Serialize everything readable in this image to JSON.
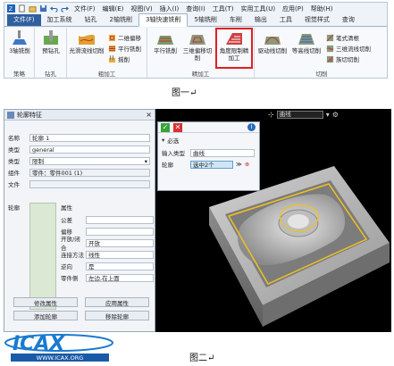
{
  "ribbon": {
    "quick_access_icons": [
      "zw-logo-icon",
      "new-icon",
      "open-icon",
      "save-icon",
      "undo-icon",
      "redo-icon"
    ],
    "menu": [
      "文件(F)",
      "编辑(E)",
      "视图(V)",
      "插入(I)",
      "查询(I)",
      "工具(T)",
      "实用工具(U)",
      "应用(P)",
      "帮助(H)"
    ],
    "tabs": [
      "文件(F)",
      "加工系统",
      "钻孔",
      "2轴铣削",
      "3轴快速铣削",
      "5轴铣削",
      "车削",
      "输出",
      "工具",
      "视觉样式",
      "查询"
    ],
    "active_tab": "3轴快速铣削",
    "groups": {
      "strategy": {
        "label": "策略",
        "button": "3轴铣削"
      },
      "drill": {
        "label": "钻孔",
        "button": "预钻孔"
      },
      "rough": {
        "label": "粗加工",
        "big": "光滑流线切削",
        "small": [
          "二维偏移",
          "平行铣削",
          "摇削"
        ]
      },
      "finish": {
        "label": "精加工",
        "buttons": [
          "平行铣削",
          "三维偏移切削",
          "角度限制精加工"
        ]
      },
      "cut": {
        "label": "切削",
        "buttons": [
          "驱动线切削",
          "等高线切削"
        ],
        "small": [
          "笔式清根",
          "三维流线切削",
          "族切切削"
        ]
      }
    },
    "accent": "#2f5f9e",
    "highlight_color": "#e02020"
  },
  "captions": {
    "fig1": "图一↵",
    "fig2": "图二↵"
  },
  "feature_panel": {
    "title": "轮廓特征",
    "fields": [
      {
        "label": "名称",
        "value": "轮廓 1"
      },
      {
        "label": "类型",
        "value": "general"
      },
      {
        "label": "类型",
        "value": "限制"
      },
      {
        "label": "组件",
        "value": "零件：零件001 (1)"
      },
      {
        "label": "文件",
        "value": ""
      }
    ],
    "section_label": "轮廓",
    "attr_header": "属性",
    "attrs": [
      {
        "label": "公差",
        "value": ""
      },
      {
        "label": "偏移",
        "value": ""
      },
      {
        "label": "开放/闭合",
        "value": "开放"
      },
      {
        "label": "连接方法",
        "value": "线性"
      },
      {
        "label": "逆向",
        "value": "是"
      },
      {
        "label": "零件侧",
        "value": "左边,在上面"
      }
    ],
    "buttons": [
      "修改属性",
      "应用属性",
      "添加轮廓",
      "移除轮廓"
    ]
  },
  "viewport": {
    "filter_value": "曲线",
    "input_panel": {
      "section": "必选",
      "input_type_label": "输入类型",
      "input_type_value": "曲线",
      "contour_label": "轮廓",
      "contour_value": "选中2个"
    }
  },
  "logo_text": "WWW.ICAX.ORG"
}
